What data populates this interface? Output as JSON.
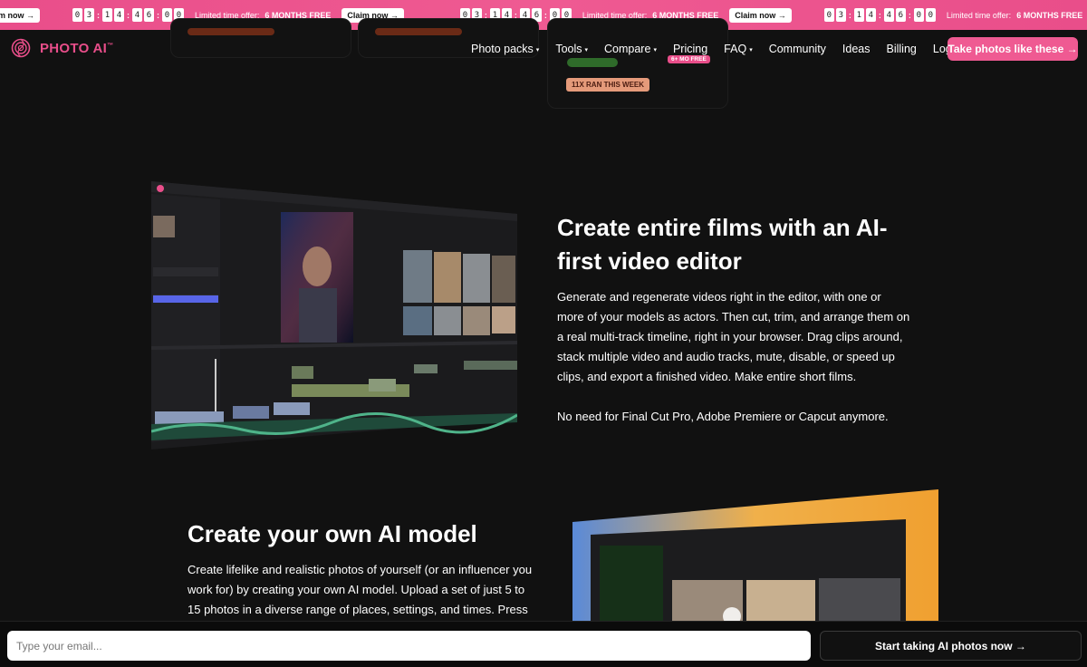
{
  "banner": {
    "claim_label": "Claim now →",
    "claim_label_cut": "m now →",
    "offer_label": "Limited time offer:",
    "offer_strong": "6 MONTHS FREE",
    "timer_digits": [
      "0",
      "3",
      "1",
      "4",
      "4",
      "6",
      "0",
      "0"
    ]
  },
  "nav": {
    "logo_text": "PHOTO AI",
    "logo_mark": "™",
    "items": [
      {
        "label": "Photo packs",
        "has_caret": true
      },
      {
        "label": "Tools",
        "has_caret": true
      },
      {
        "label": "Compare",
        "has_caret": true
      },
      {
        "label": "Pricing",
        "badge": "6+ MO FREE"
      },
      {
        "label": "FAQ",
        "has_caret": true
      },
      {
        "label": "Community"
      },
      {
        "label": "Ideas"
      },
      {
        "label": "Billing"
      },
      {
        "label": "Log in"
      }
    ],
    "caret": "▾",
    "cta_label": "Take photos like these →"
  },
  "top_cards": {
    "ran_badge": "11X RAN THIS WEEK"
  },
  "section_video": {
    "heading": "Create entire films with an AI-first video editor",
    "paragraph": "Generate and regenerate videos right in the editor, with one or more of your models as actors. Then cut, trim, and arrange them on a real multi-track timeline, right in your browser. Drag clips around, stack multiple video and audio tracks, mute, disable, or speed up clips, and export a finished video. Make entire short films.",
    "paragraph2": "No need for Final Cut Pro, Adobe Premiere or Capcut anymore."
  },
  "section_model": {
    "heading": "Create your own AI model",
    "paragraph": "Create lifelike and realistic photos of yourself (or an influencer you work for) by creating your own AI model. Upload a set of just 5 to 15 photos in a diverse range of places, settings, and times. Press"
  },
  "bottom_bar": {
    "email_placeholder": "Type your email...",
    "start_label": "Start taking AI photos now →"
  },
  "colors": {
    "accent": "#e94e8a",
    "background": "#111111"
  }
}
